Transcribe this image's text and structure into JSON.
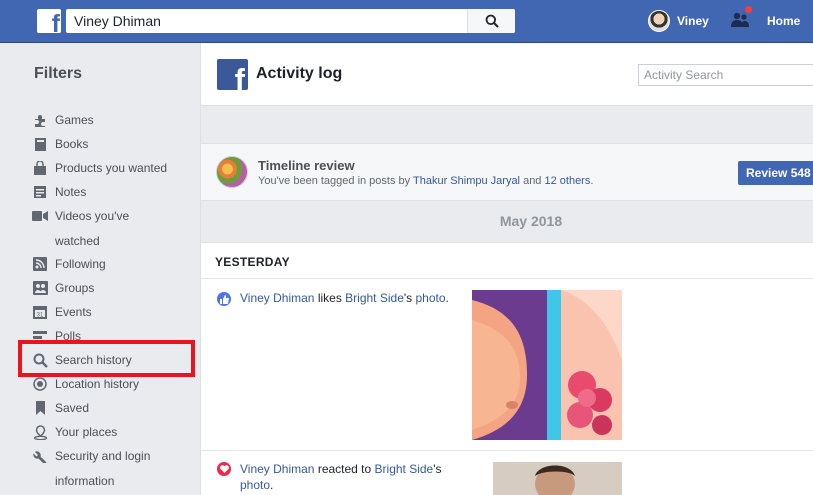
{
  "topbar": {
    "search_value": "Viney Dhiman",
    "user_name": "Viney",
    "home_label": "Home"
  },
  "sidebar": {
    "title": "Filters",
    "items": [
      {
        "label": "Games",
        "icon": "puzzle-icon"
      },
      {
        "label": "Books",
        "icon": "book-icon"
      },
      {
        "label": "Products you wanted",
        "icon": "bag-icon"
      },
      {
        "label": "Notes",
        "icon": "note-icon"
      },
      {
        "label": "Videos you've",
        "label2": "watched",
        "icon": "video-icon"
      },
      {
        "label": "Following",
        "icon": "rss-icon"
      },
      {
        "label": "Groups",
        "icon": "group-icon"
      },
      {
        "label": "Events",
        "icon": "calendar-icon"
      },
      {
        "label": "Polls",
        "icon": "poll-icon"
      },
      {
        "label": "Search history",
        "icon": "search-icon"
      },
      {
        "label": "Location history",
        "icon": "location-icon"
      },
      {
        "label": "Saved",
        "icon": "bookmark-icon"
      },
      {
        "label": "Your places",
        "icon": "place-icon"
      },
      {
        "label": "Security and login",
        "label2": "information",
        "icon": "wrench-icon"
      }
    ]
  },
  "header": {
    "title": "Activity log",
    "search_placeholder": "Activity Search"
  },
  "timeline_review": {
    "title": "Timeline review",
    "desc_prefix": "You've been tagged in posts by ",
    "desc_name": "Thakur Shimpu Jaryal",
    "desc_mid": " and ",
    "desc_others": "12 others",
    "desc_suffix": ".",
    "button_label": "Review 548"
  },
  "month": "May 2018",
  "activity": {
    "day": "YESTERDAY",
    "entries": [
      {
        "actor": "Viney Dhiman",
        "verb": " likes ",
        "page": "Bright Side",
        "suffix": "'s ",
        "object": "photo",
        "end": "."
      },
      {
        "actor": "Viney Dhiman",
        "verb": " reacted to ",
        "page": "Bright Side",
        "suffix": "'s",
        "object": "photo",
        "end": "."
      }
    ]
  },
  "colors": {
    "brand": "#4267b2",
    "highlight": "#e8141f",
    "link": "#365899"
  }
}
